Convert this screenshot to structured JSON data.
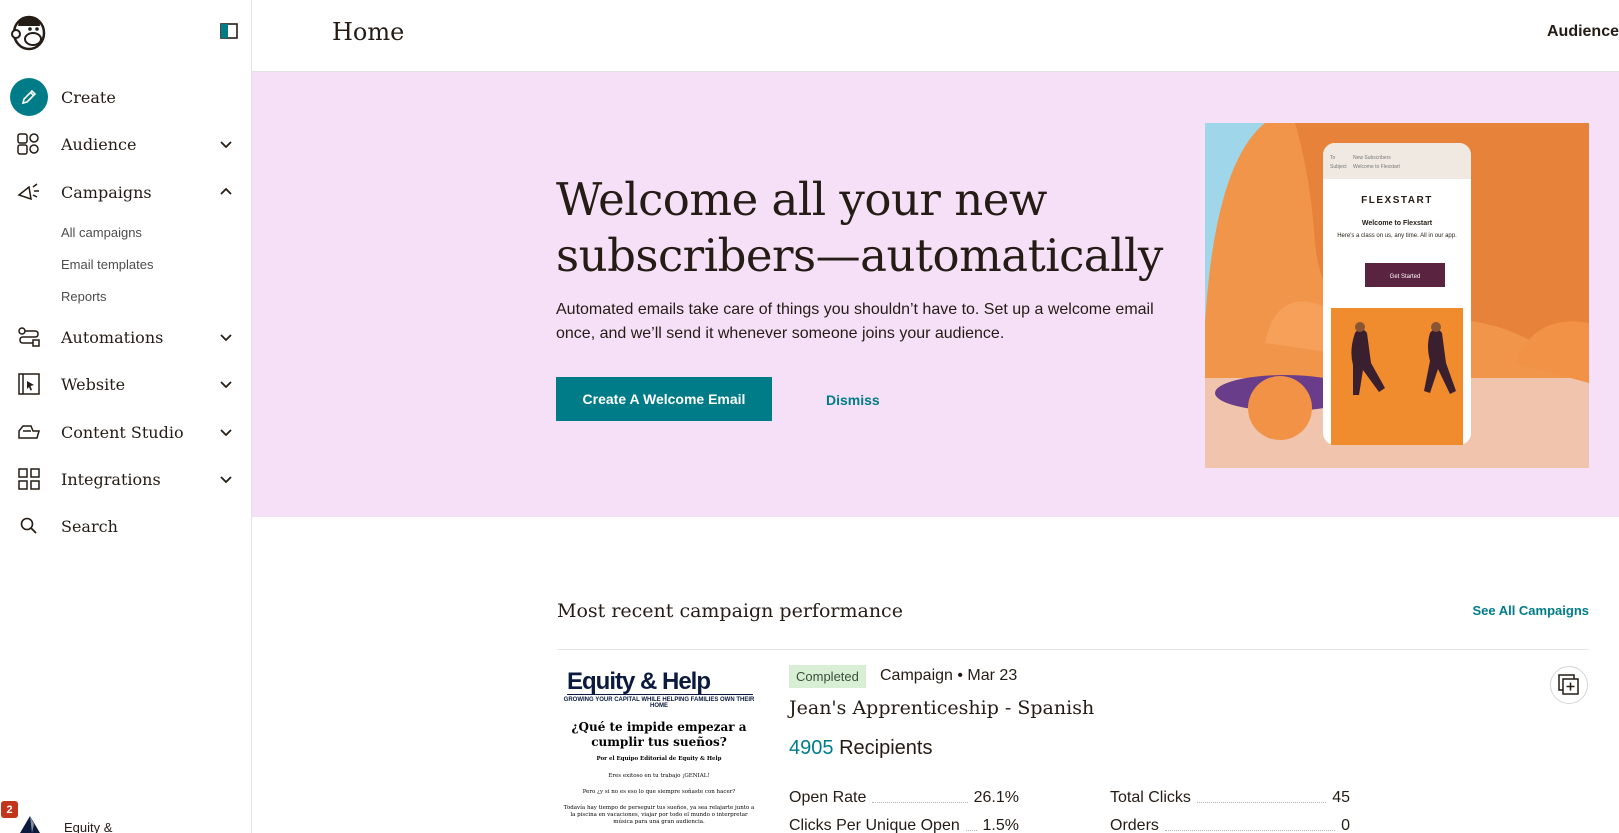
{
  "sidebar": {
    "nav": [
      {
        "label": "Create",
        "icon": "pencil-icon"
      },
      {
        "label": "Audience",
        "icon": "audience-icon"
      },
      {
        "label": "Campaigns",
        "icon": "megaphone-icon"
      },
      {
        "label": "Automations",
        "icon": "automations-icon"
      },
      {
        "label": "Website",
        "icon": "website-icon"
      },
      {
        "label": "Content Studio",
        "icon": "content-studio-icon"
      },
      {
        "label": "Integrations",
        "icon": "integrations-icon"
      },
      {
        "label": "Search",
        "icon": "search-icon"
      }
    ],
    "campaign_subitems": [
      "All campaigns",
      "Email templates",
      "Reports"
    ],
    "account": {
      "notifications": "2",
      "name": "Equity &"
    }
  },
  "header": {
    "title": "Home",
    "right_label": "Audience"
  },
  "hero": {
    "title": "Welcome all your new subscribers—automatically",
    "text": "Automated emails take care of things you shouldn’t have to. Set up a welcome email once, and we’ll send it whenever someone joins your audience.",
    "primary_button": "Create A Welcome Email",
    "dismiss": "Dismiss",
    "illustration": {
      "to_label": "To",
      "to_value": "New Subscribers",
      "subject_label": "Subject",
      "subject_value": "Welcome to Flexstart",
      "brand": "FLEXSTART",
      "heading": "Welcome to Flexstart",
      "body": "Here's a class on us, any time. All in our app.",
      "button": "Get Started"
    },
    "background_color": "#f6e0f7"
  },
  "performance": {
    "title": "Most recent campaign performance",
    "see_all": "See All Campaigns",
    "campaign": {
      "status": "Completed",
      "meta": "Campaign • Mar 23",
      "name": "Jean's Apprenticeship - Spanish",
      "recipients_count": "4905",
      "recipients_label": "Recipients",
      "thumbnail": {
        "brand": "Equity & Help",
        "tagline": "GROWING YOUR CAPITAL WHILE HELPING FAMILIES OWN THEIR HOME",
        "headline": "¿Qué te impide empezar a cumplir tus sueños?",
        "byline": "Por el Equipo Editorial de Equity & Help",
        "line1": "Eres exitoso en tu trabajo ¡GENIAL!",
        "line2": "Pero ¿y si no es eso lo que siempre soñaste con hacer?",
        "line3": "Todavía hay tiempo de perseguir tus sueños, ya sea relajarte junto a la piscina en vacaciones, viajar por todo el mundo o interpretar música para una gran audiencia."
      },
      "stats_left": [
        {
          "label": "Open Rate",
          "value": "26.1%"
        },
        {
          "label": "Clicks Per Unique Open",
          "value": "1.5%"
        }
      ],
      "stats_right": [
        {
          "label": "Total Clicks",
          "value": "45"
        },
        {
          "label": "Orders",
          "value": "0"
        }
      ]
    }
  },
  "colors": {
    "accent": "#007c89",
    "hero_bg": "#f6e0f7",
    "badge_bg": "#d9efd5"
  }
}
